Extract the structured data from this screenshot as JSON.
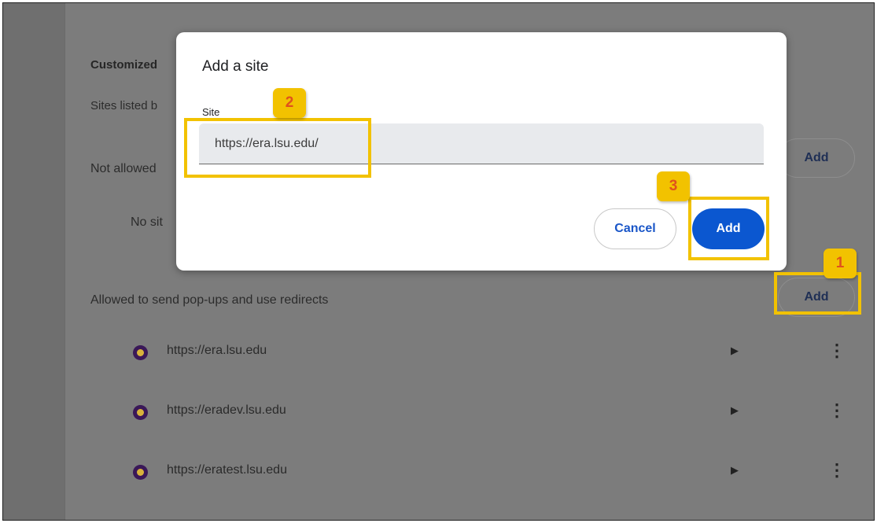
{
  "background": {
    "section_title": "Customized",
    "section_desc": "Sites listed b",
    "not_allowed_label": "Not allowed",
    "not_allowed_empty": "No sit",
    "allowed_label": "Allowed to send pop-ups and use redirects",
    "add_label": "Add",
    "sites": [
      {
        "url": "https://era.lsu.edu"
      },
      {
        "url": "https://eradev.lsu.edu"
      },
      {
        "url": "https://eratest.lsu.edu"
      }
    ]
  },
  "dialog": {
    "title": "Add a site",
    "field_label": "Site",
    "field_value": "https://era.lsu.edu/",
    "cancel_label": "Cancel",
    "add_label": "Add"
  },
  "annotations": {
    "badges": [
      "1",
      "2",
      "3"
    ],
    "color": "#f2c200"
  },
  "colors": {
    "accent": "#0b57d0",
    "overlay": "#7c7c7c"
  }
}
